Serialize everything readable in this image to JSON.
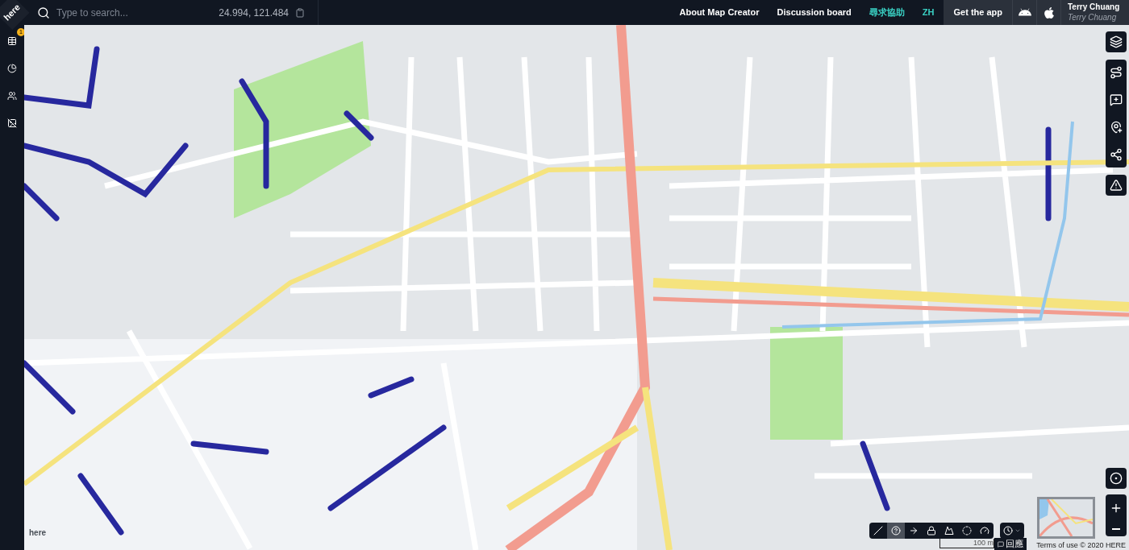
{
  "logo": {
    "text": "here"
  },
  "search": {
    "placeholder": "Type to search...",
    "coordinates": "24.994, 121.484"
  },
  "nav_links": [
    {
      "label": "About Map Creator",
      "color": "#ffffff"
    },
    {
      "label": "Discussion board",
      "color": "#ffffff"
    },
    {
      "label": "尋求協助",
      "color": "#3ad1c4"
    },
    {
      "label": "ZH",
      "color": "#3ad1c4"
    }
  ],
  "get_app": {
    "label": "Get the app"
  },
  "user": {
    "name": "Terry Chuang",
    "subtitle": "Terry Chuang"
  },
  "sidebar": {
    "items": [
      {
        "kind": "table",
        "badge": "1"
      },
      {
        "kind": "chart"
      },
      {
        "kind": "people"
      },
      {
        "kind": "image"
      }
    ]
  },
  "map_tools": [
    {
      "kind": "road"
    },
    {
      "kind": "comment"
    },
    {
      "kind": "poi"
    },
    {
      "kind": "node"
    }
  ],
  "edit_tools": [
    {
      "kind": "line",
      "selected": false
    },
    {
      "kind": "help",
      "selected": true
    },
    {
      "kind": "arrow",
      "selected": false
    },
    {
      "kind": "lock",
      "selected": false
    },
    {
      "kind": "hill",
      "selected": false
    },
    {
      "kind": "target",
      "selected": false
    },
    {
      "kind": "gauge",
      "selected": false
    }
  ],
  "scale": {
    "label": "100 m"
  },
  "feedback": {
    "label": "回應"
  },
  "footer": {
    "terms": "Terms of use © 2020 HERE"
  },
  "watermark_logo": {
    "text": "here"
  }
}
